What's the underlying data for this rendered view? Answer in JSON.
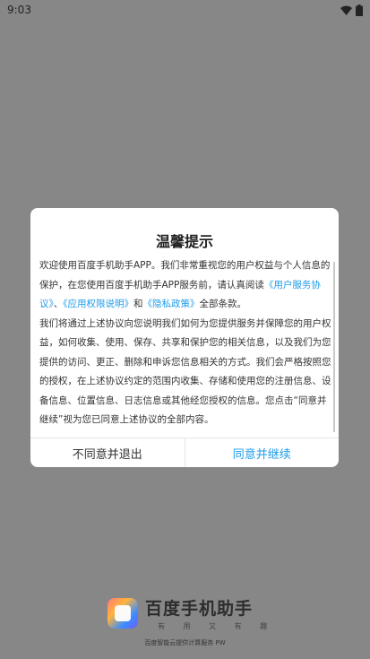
{
  "status_bar": {
    "time": "9:03"
  },
  "splash": {
    "logo_title": "百度手机助手",
    "tagline": "有 用 又 有 趣",
    "footer": "百度智能云提供计算服务 PW"
  },
  "dialog": {
    "title": "温馨提示",
    "intro_1": "欢迎使用百度手机助手APP。我们非常重视您的用户权益与个人信息的保护，在您使用百度手机助手APP服务前，请认真阅读",
    "link_terms": "《用户服务协议》",
    "sep_1": "、",
    "link_permissions": "《应用权限说明》",
    "sep_2": "和",
    "link_privacy": "《隐私政策》",
    "intro_end": "全部条款。",
    "paragraph_2": "我们将通过上述协议向您说明我们如何为您提供服务并保障您的用户权益，如何收集、使用、保存、共享和保护您的相关信息，以及我们为您提供的访问、更正、删除和申诉您信息相关的方式。我们会严格按照您的授权，在上述协议约定的范围内收集、存储和使用您的注册信息、设备信息、位置信息、日志信息或其他经您授权的信息。您点击“同意并继续”视为您已同意上述协议的全部内容。",
    "disagree_label": "不同意并退出",
    "agree_label": "同意并继续"
  },
  "colors": {
    "link": "#1f9be8",
    "overlay": "#878787"
  }
}
